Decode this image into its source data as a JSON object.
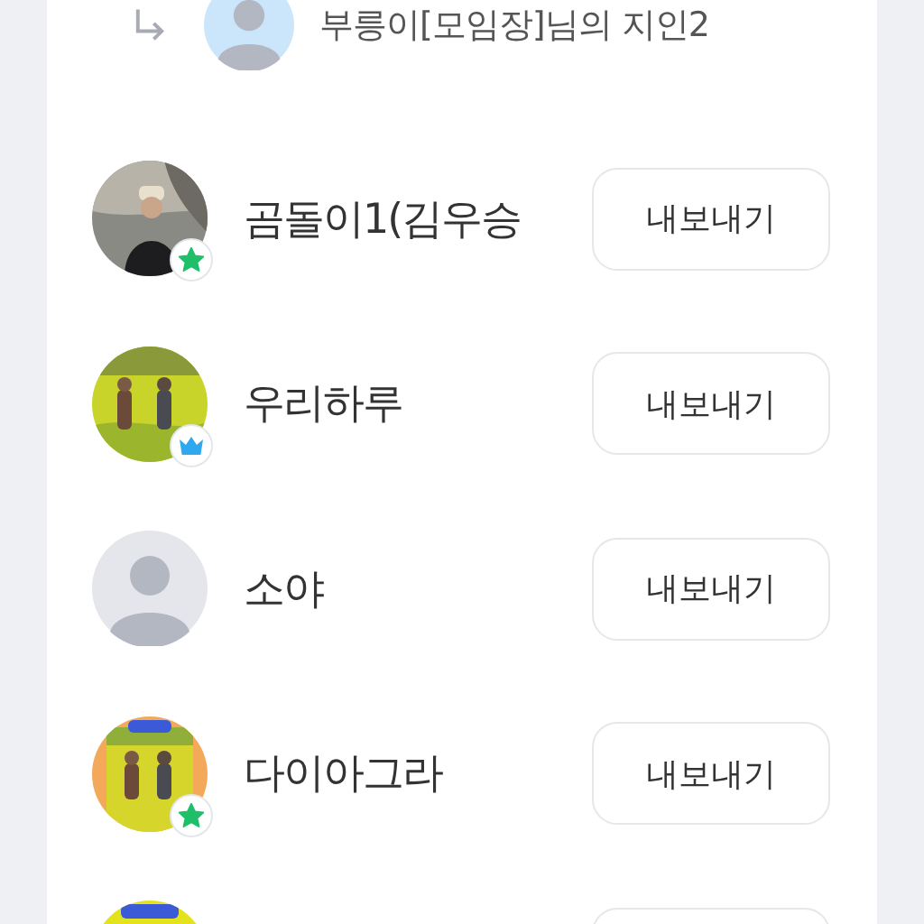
{
  "parent": {
    "label": "부릉이[모임장]님의 지인2",
    "avatar": {
      "kind": "default"
    }
  },
  "members": [
    {
      "name": "곰돌이1(김우승",
      "avatar": {
        "kind": "picture"
      },
      "badge": {
        "kind": "star"
      },
      "button": "내보내기"
    },
    {
      "name": "우리하루",
      "avatar": {
        "kind": "picture"
      },
      "badge": {
        "kind": "crown"
      },
      "button": "내보내기"
    },
    {
      "name": "소야",
      "avatar": {
        "kind": "default"
      },
      "button": "내보내기"
    },
    {
      "name": "다이아그라",
      "avatar": {
        "kind": "picture"
      },
      "badge": {
        "kind": "star"
      },
      "button": "내보내기"
    },
    {
      "avatar": {
        "kind": "picture"
      }
    }
  ]
}
